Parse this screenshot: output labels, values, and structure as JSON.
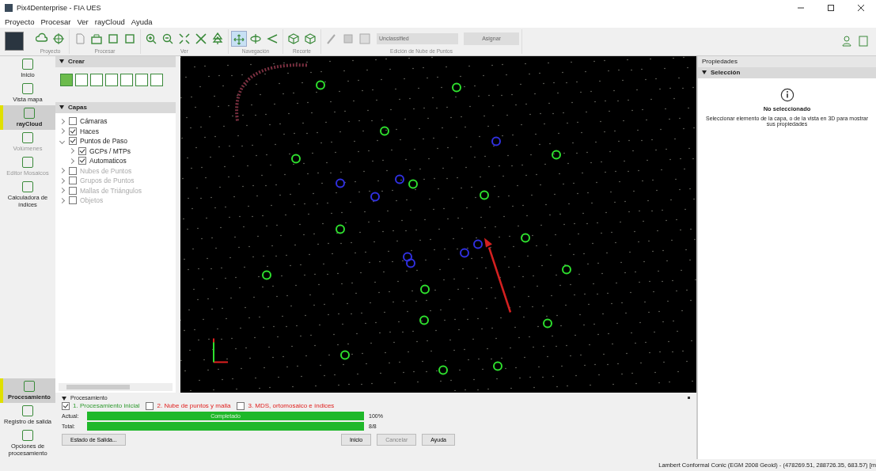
{
  "window": {
    "title": "Pix4Denterprise - FIA UES"
  },
  "menu": [
    "Proyecto",
    "Procesar",
    "Ver",
    "rayCloud",
    "Ayuda"
  ],
  "toolbar": {
    "groups": [
      {
        "label": "Proyecto",
        "buttons": [
          {
            "kind": "cloud",
            "selected": false
          },
          {
            "kind": "target",
            "selected": false
          }
        ]
      },
      {
        "label": "Procesar",
        "buttons": [
          {
            "kind": "doc",
            "selected": false
          },
          {
            "kind": "box",
            "selected": false
          },
          {
            "kind": "frame",
            "selected": false
          },
          {
            "kind": "frame",
            "selected": false
          }
        ]
      },
      {
        "label": "Ver",
        "buttons": [
          {
            "kind": "zoomin",
            "selected": false
          },
          {
            "kind": "zoomout",
            "selected": false
          },
          {
            "kind": "expand",
            "selected": false
          },
          {
            "kind": "shrink",
            "selected": false
          },
          {
            "kind": "tree",
            "selected": false
          }
        ]
      },
      {
        "label": "Navegación",
        "buttons": [
          {
            "kind": "pan",
            "selected": true
          },
          {
            "kind": "orbit",
            "selected": false
          },
          {
            "kind": "fly",
            "selected": false
          }
        ]
      },
      {
        "label": "Recorte",
        "buttons": [
          {
            "kind": "cube",
            "selected": false
          },
          {
            "kind": "cube",
            "selected": false
          }
        ]
      }
    ],
    "edit_group": {
      "label": "Edición de Nube de Puntos",
      "dropdown": "Unclassified",
      "button": "Asignar"
    }
  },
  "nav": [
    {
      "label": "Inicio",
      "selected": false,
      "disabled": false
    },
    {
      "label": "Vista mapa",
      "selected": false,
      "disabled": false
    },
    {
      "label": "rayCloud",
      "selected": true,
      "disabled": false
    },
    {
      "label": "Volúmenes",
      "selected": false,
      "disabled": true
    },
    {
      "label": "Editor Mosaicos",
      "selected": false,
      "disabled": true
    },
    {
      "label": "Calculadora de índices",
      "selected": false,
      "disabled": false
    }
  ],
  "nav_bottom": [
    {
      "label": "Procesamiento",
      "selected": true
    },
    {
      "label": "Registro de salida",
      "selected": false
    },
    {
      "label": "Opciones de procesamiento",
      "selected": false
    }
  ],
  "create": {
    "title": "Crear",
    "tools": [
      {
        "selected": true
      },
      {
        "selected": false
      },
      {
        "selected": false
      },
      {
        "selected": false
      },
      {
        "selected": false
      },
      {
        "selected": false
      },
      {
        "selected": false
      }
    ]
  },
  "layers": {
    "title": "Capas",
    "items": [
      {
        "label": "Cámaras",
        "checked": false,
        "expanded": false,
        "disabled": false
      },
      {
        "label": "Haces",
        "checked": true,
        "expanded": false,
        "disabled": false
      },
      {
        "label": "Puntos de Paso",
        "checked": true,
        "expanded": true,
        "disabled": false,
        "children": [
          {
            "label": "GCPs / MTPs",
            "checked": true
          },
          {
            "label": "Automaticos",
            "checked": true
          }
        ]
      },
      {
        "label": "Nubes de Puntos",
        "checked": false,
        "expanded": false,
        "disabled": true
      },
      {
        "label": "Grupos de Puntos",
        "checked": false,
        "expanded": false,
        "disabled": true
      },
      {
        "label": "Mallas de Triángulos",
        "checked": false,
        "expanded": false,
        "disabled": true
      },
      {
        "label": "Objetos",
        "checked": false,
        "expanded": false,
        "disabled": true
      }
    ]
  },
  "properties": {
    "title": "Propiedades",
    "section": "Selección",
    "heading": "No seleccionado",
    "text": "Seleccionar elemento de la capa, o de la vista en 3D para mostrar sus propiedades"
  },
  "processing": {
    "title": "Procesamiento",
    "steps": [
      {
        "label": "1. Procesamiento inicial",
        "checked": true,
        "done": true
      },
      {
        "label": "2. Nube de puntos y malla",
        "checked": false,
        "done": false
      },
      {
        "label": "3. MDS, ortomosaico e índices",
        "checked": false,
        "done": false
      }
    ],
    "bars": [
      {
        "label": "Actual:",
        "text": "Completado",
        "level": 1,
        "reading": "100%"
      },
      {
        "label": "Total:",
        "level": 1,
        "reading": "8/8"
      }
    ],
    "buttons": [
      {
        "label": "Estado de Salida...",
        "disabled": false
      },
      {
        "label": "Inicio",
        "disabled": false
      },
      {
        "label": "Cancelar",
        "disabled": true
      },
      {
        "label": "Ayuda",
        "disabled": false
      }
    ]
  },
  "status_bar": "Lambert Conformal Conic (EGM 2008 Geoid) - (478269.51, 288726.35, 683.57) [m"
}
